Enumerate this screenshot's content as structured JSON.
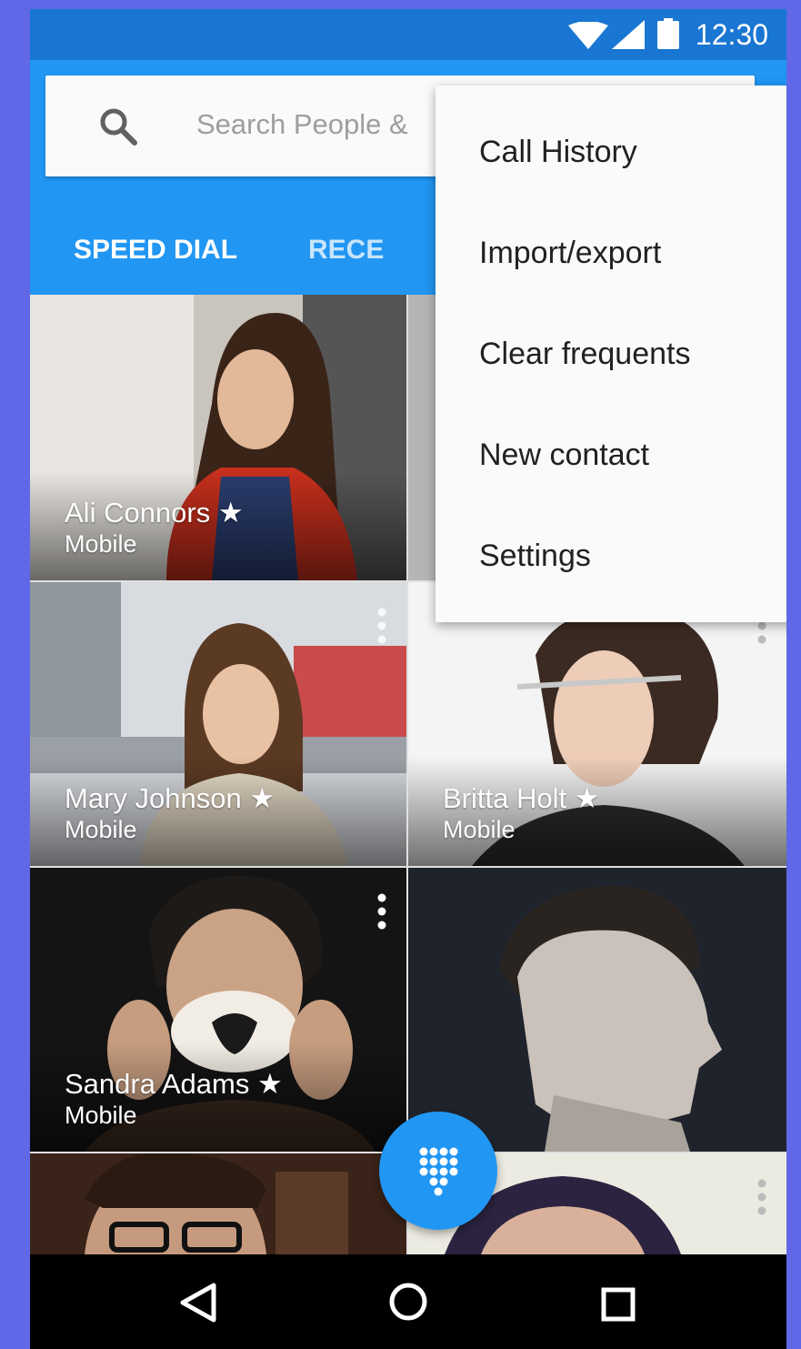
{
  "status_bar": {
    "time": "12:30",
    "icons": [
      "wifi-icon",
      "signal-icon",
      "battery-icon"
    ]
  },
  "search": {
    "placeholder": "Search People &",
    "icon": "search-icon"
  },
  "tabs": [
    {
      "label": "SPEED DIAL",
      "active": true
    },
    {
      "label": "RECE",
      "active": false
    }
  ],
  "menu": {
    "items": [
      {
        "label": "Call History"
      },
      {
        "label": "Import/export"
      },
      {
        "label": "Clear frequents"
      },
      {
        "label": "New contact"
      },
      {
        "label": "Settings"
      }
    ]
  },
  "contacts": [
    {
      "name": "Ali Connors ★",
      "label": "Mobile"
    },
    {
      "name": "Mary Johnson ★",
      "label": "Mobile"
    },
    {
      "name": "Britta Holt ★",
      "label": "Mobile"
    },
    {
      "name": "Sandra Adams ★",
      "label": "Mobile"
    },
    {
      "name": "",
      "label": ""
    },
    {
      "name": "",
      "label": ""
    },
    {
      "name": "",
      "label": ""
    }
  ],
  "fab": {
    "icon": "dialpad-icon"
  },
  "nav": {
    "icons": [
      "back-icon",
      "home-icon",
      "recents-icon"
    ]
  },
  "colors": {
    "status_bar": "#1976d2",
    "app_bar": "#2196f3",
    "fab": "#2196f3",
    "background": "#6168e8"
  }
}
